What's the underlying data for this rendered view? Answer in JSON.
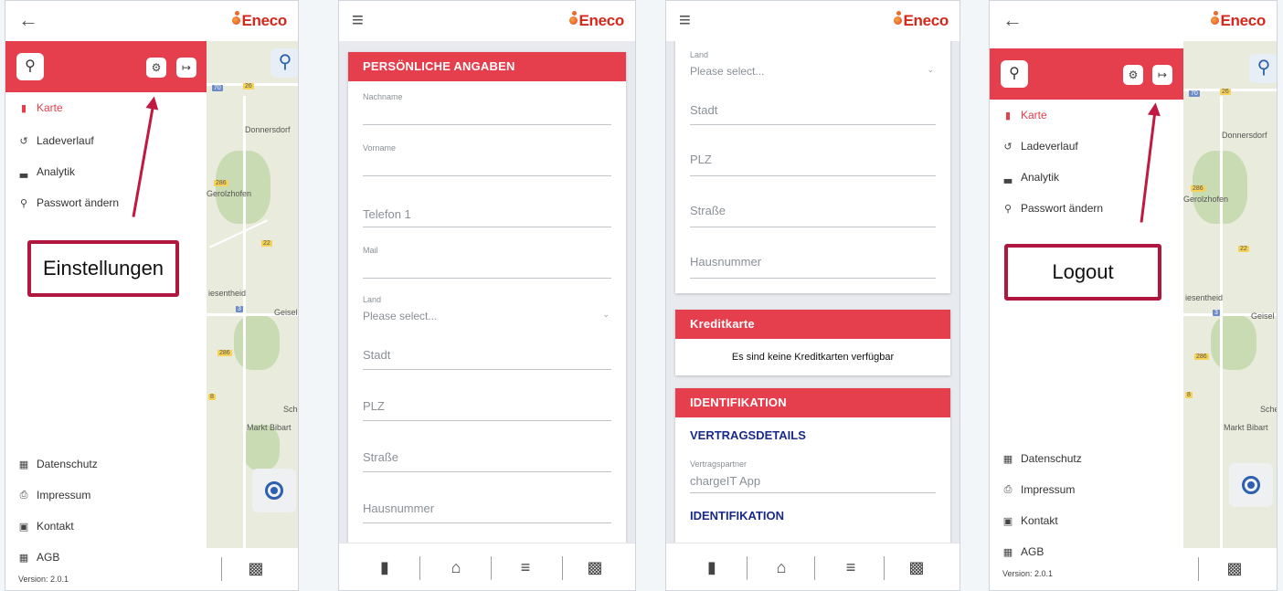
{
  "brand": {
    "logo_text": "Eneco",
    "accent": "#e53e4d",
    "logo_red": "#d4281c"
  },
  "nav_icons": {
    "back": "arrow-left-icon",
    "menu": "hamburger-icon"
  },
  "drawer": {
    "menu": [
      {
        "label": "Karte",
        "icon": "map-icon",
        "active": true
      },
      {
        "label": "Ladeverlauf",
        "icon": "history-icon"
      },
      {
        "label": "Analytik",
        "icon": "bar-chart-icon"
      },
      {
        "label": "Passwort ändern",
        "icon": "key-icon"
      }
    ],
    "footer": [
      {
        "label": "Datenschutz",
        "icon": "document-icon"
      },
      {
        "label": "Impressum",
        "icon": "printer-icon"
      },
      {
        "label": "Kontakt",
        "icon": "contact-icon"
      },
      {
        "label": "AGB",
        "icon": "document-icon"
      }
    ],
    "version": "Version: 2.0.1"
  },
  "map": {
    "labels": {
      "donnersdorf": "Donnersdorf",
      "gerolzhofen": "Gerolzhofen",
      "wiesentheid": "iesentheid",
      "geisel": "Geisel",
      "schein": "Schein",
      "marktbibart": "Markt Bibart"
    },
    "road_numbers": {
      "r70": "70",
      "r26": "26",
      "r286a": "286",
      "r22": "22",
      "r3": "3",
      "r286b": "286",
      "r8": "8"
    }
  },
  "annotations": {
    "settings": "Einstellungen",
    "logout": "Logout"
  },
  "screen2": {
    "section_title": "PERSÖNLICHE ANGABEN",
    "fields": {
      "nachname": "Nachname",
      "vorname": "Vorname",
      "telefon": "Telefon 1",
      "mail": "Mail",
      "land": "Land",
      "land_placeholder": "Please select...",
      "stadt": "Stadt",
      "plz": "PLZ",
      "strasse": "Straße",
      "hausnummer": "Hausnummer"
    }
  },
  "screen3": {
    "fields": {
      "land": "Land",
      "land_placeholder": "Please select...",
      "stadt": "Stadt",
      "plz": "PLZ",
      "strasse": "Straße",
      "hausnummer": "Hausnummer"
    },
    "kreditkarte_title": "Kreditkarte",
    "kreditkarte_empty": "Es sind keine Kreditkarten verfügbar",
    "identifikation_title": "IDENTIFIKATION",
    "vertragsdetails": "VERTRAGSDETAILS",
    "vertragspartner_label": "Vertragspartner",
    "vertragspartner_value": "chargeIT App",
    "identifikation_sub": "IDENTIFIKATION"
  },
  "bottom_nav": [
    "map-icon",
    "home-icon",
    "favorites-icon",
    "qr-code-icon"
  ]
}
